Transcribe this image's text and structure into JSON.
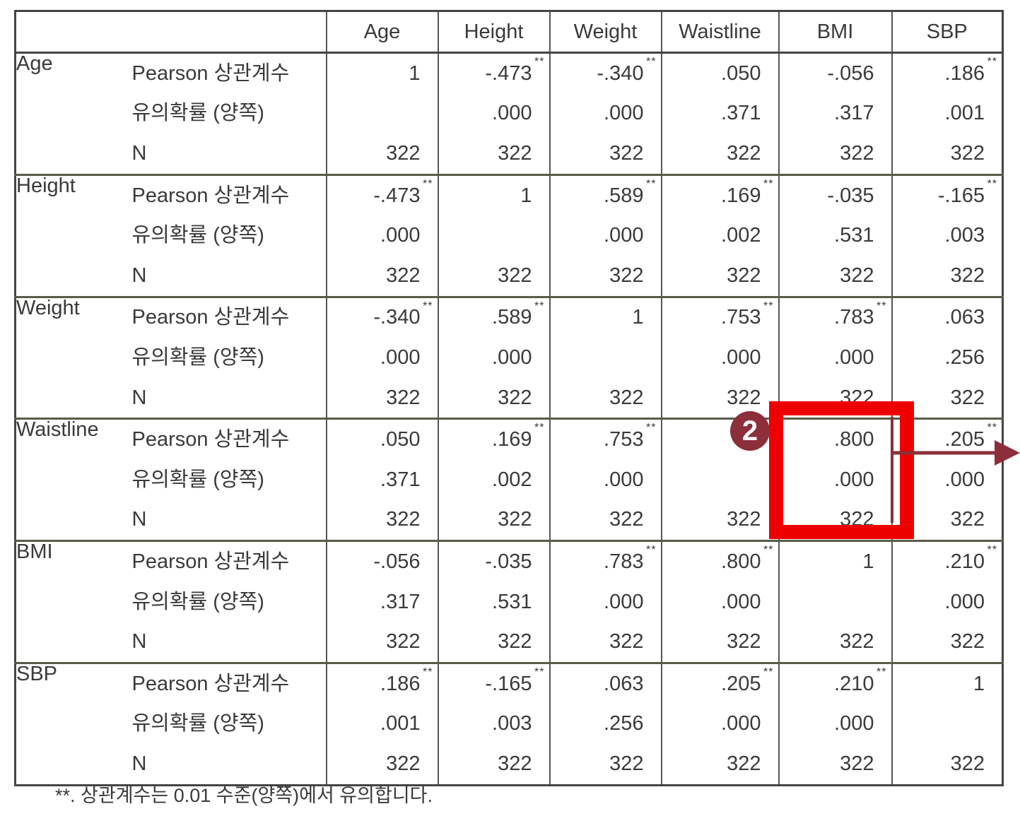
{
  "columns": [
    "Age",
    "Height",
    "Weight",
    "Waistline",
    "BMI",
    "SBP"
  ],
  "stat_labels": [
    "Pearson 상관계수",
    "유의확률 (양쪽)",
    "N"
  ],
  "sig_mark": "**",
  "rows": [
    {
      "name": "Age",
      "pearson": [
        "1",
        "-.473",
        "-.340",
        ".050",
        "-.056",
        ".186"
      ],
      "pearson_sig": [
        "",
        "**",
        "**",
        "",
        "",
        "**"
      ],
      "sig": [
        "",
        ".000",
        ".000",
        ".371",
        ".317",
        ".001"
      ],
      "n": [
        "322",
        "322",
        "322",
        "322",
        "322",
        "322"
      ]
    },
    {
      "name": "Height",
      "pearson": [
        "-.473",
        "1",
        ".589",
        ".169",
        "-.035",
        "-.165"
      ],
      "pearson_sig": [
        "**",
        "",
        "**",
        "**",
        "",
        "**"
      ],
      "sig": [
        ".000",
        "",
        ".000",
        ".002",
        ".531",
        ".003"
      ],
      "n": [
        "322",
        "322",
        "322",
        "322",
        "322",
        "322"
      ]
    },
    {
      "name": "Weight",
      "pearson": [
        "-.340",
        ".589",
        "1",
        ".753",
        ".783",
        ".063"
      ],
      "pearson_sig": [
        "**",
        "**",
        "",
        "**",
        "**",
        ""
      ],
      "sig": [
        ".000",
        ".000",
        "",
        ".000",
        ".000",
        ".256"
      ],
      "n": [
        "322",
        "322",
        "322",
        "322",
        "322",
        "322"
      ]
    },
    {
      "name": "Waistline",
      "pearson": [
        ".050",
        ".169",
        ".753",
        "",
        ".800",
        ".205"
      ],
      "pearson_sig": [
        "",
        "**",
        "**",
        "",
        "",
        "**"
      ],
      "sig": [
        ".371",
        ".002",
        ".000",
        "",
        ".000",
        ".000"
      ],
      "n": [
        "322",
        "322",
        "322",
        "322",
        "322",
        "322"
      ]
    },
    {
      "name": "BMI",
      "pearson": [
        "-.056",
        "-.035",
        ".783",
        ".800",
        "1",
        ".210"
      ],
      "pearson_sig": [
        "",
        "",
        "**",
        "**",
        "",
        "**"
      ],
      "sig": [
        ".317",
        ".531",
        ".000",
        ".000",
        "",
        ".000"
      ],
      "n": [
        "322",
        "322",
        "322",
        "322",
        "322",
        "322"
      ]
    },
    {
      "name": "SBP",
      "pearson": [
        ".186",
        "-.165",
        ".063",
        ".205",
        ".210",
        "1"
      ],
      "pearson_sig": [
        "**",
        "**",
        "",
        "**",
        "**",
        ""
      ],
      "sig": [
        ".001",
        ".003",
        ".256",
        ".000",
        ".000",
        ""
      ],
      "n": [
        "322",
        "322",
        "322",
        "322",
        "322",
        "322"
      ]
    }
  ],
  "footnote": "**. 상관계수는 0.01 수준(양쪽)에서 유의합니다.",
  "annotation": {
    "marker_label": "2",
    "marker_color": "#8c2f3a",
    "highlight_color": "#ee0000",
    "arrow_color": "#8c2f3a"
  }
}
